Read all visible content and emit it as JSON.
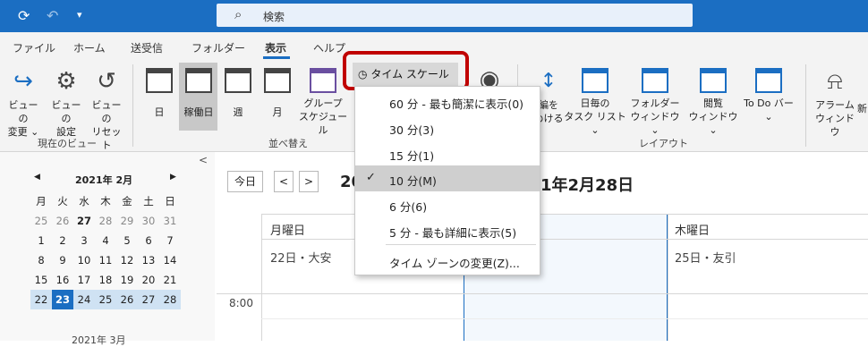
{
  "titlebar": {
    "sync_icon": "⟳",
    "undo_icon": "↶",
    "qat_icon": "▾",
    "search_placeholder": "検索"
  },
  "tabs": [
    "ファイル",
    "ホーム",
    "送受信",
    "フォルダー",
    "表示",
    "ヘルプ"
  ],
  "ribbon": {
    "current_view": {
      "buttons": [
        {
          "label1": "ビューの",
          "label2": "変更 ⌄"
        },
        {
          "label1": "ビューの",
          "label2": "設定"
        },
        {
          "label1": "ビューの",
          "label2": "リセット"
        }
      ],
      "group_label": "現在のビュー"
    },
    "arrange": {
      "buttons": [
        "日",
        "稼働日",
        "週",
        "月"
      ],
      "group_button": {
        "label1": "グループ",
        "label2": "スケジュール"
      },
      "group_label": "並べ替え"
    },
    "timescale_label": "タイム スケール ⌄",
    "layout": {
      "buttons": [
        {
          "label1": "日毎の",
          "label2": "タスク リスト ⌄"
        },
        {
          "label1": "フォルダー",
          "label2": "ウィンドウ ⌄"
        },
        {
          "label1": "閲覧",
          "label2": "ウィンドウ ⌄"
        },
        {
          "label1": "To Do バー",
          "label2": "⌄"
        }
      ],
      "partial_label1": "編を",
      "partial_label2": "めける",
      "group_label": "レイアウト"
    },
    "alarm": {
      "label1": "アラーム",
      "label2": "ウィンドウ",
      "partial": "新"
    }
  },
  "timescale_menu": {
    "items": [
      {
        "label": "60 分 - 最も簡潔に表示(0)",
        "selected": false
      },
      {
        "label": "30 分(3)",
        "selected": false
      },
      {
        "label": "15 分(1)",
        "selected": false
      },
      {
        "label": "10 分(M)",
        "selected": true
      },
      {
        "label": "6 分(6)",
        "selected": false
      },
      {
        "label": "5 分 - 最も詳細に表示(5)",
        "selected": false
      }
    ],
    "timezone_item": "タイム ゾーンの変更(Z)...",
    "check_mark": "✓"
  },
  "minical": {
    "title": "2021年 2月",
    "weekdays": [
      "月",
      "火",
      "水",
      "木",
      "金",
      "土",
      "日"
    ],
    "rows": [
      [
        "25",
        "26",
        "27",
        "28",
        "29",
        "30",
        "31"
      ],
      [
        "1",
        "2",
        "3",
        "4",
        "5",
        "6",
        "7"
      ],
      [
        "8",
        "9",
        "10",
        "11",
        "12",
        "13",
        "14"
      ],
      [
        "15",
        "16",
        "17",
        "18",
        "19",
        "20",
        "21"
      ],
      [
        "22",
        "23",
        "24",
        "25",
        "26",
        "27",
        "28"
      ]
    ],
    "next_title": "2021年 3月"
  },
  "calendar": {
    "today_button": "今日",
    "prev": "<",
    "next": ">",
    "range_title_left": "20",
    "range_title_right": "1年2月28日",
    "days": [
      {
        "name": "月曜日",
        "info": "22日・大安"
      },
      {
        "name": "木曜日",
        "info": "25日・友引"
      }
    ],
    "time_label": "8:00",
    "collapse": "<"
  }
}
